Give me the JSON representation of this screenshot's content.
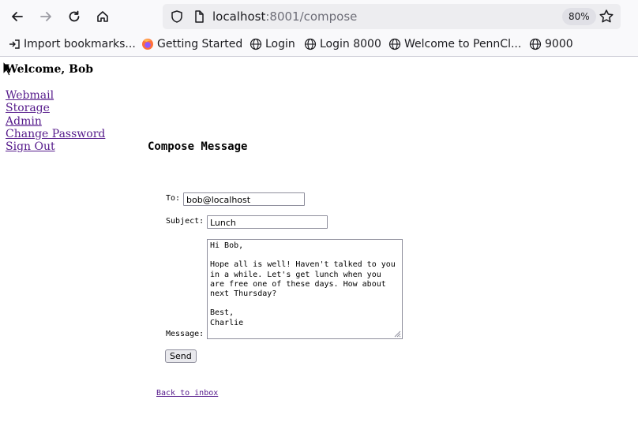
{
  "browser": {
    "url_host": "localhost",
    "url_rest": ":8001/compose",
    "zoom": "80%",
    "bookmarks": [
      {
        "label": "Import bookmarks...",
        "icon": "import-icon"
      },
      {
        "label": "Getting Started",
        "icon": "firefox-icon"
      },
      {
        "label": "Login",
        "icon": "globe-icon"
      },
      {
        "label": "Login 8000",
        "icon": "globe-icon"
      },
      {
        "label": "Welcome to PennCl...",
        "icon": "globe-icon"
      },
      {
        "label": "9000",
        "icon": "globe-icon"
      }
    ]
  },
  "page": {
    "welcome": "Welcome, Bob",
    "nav": [
      "Webmail",
      "Storage",
      "Admin",
      "Change Password",
      "Sign Out"
    ],
    "heading": "Compose Message",
    "form": {
      "to_label": "To:",
      "to_value": "bob@localhost",
      "subject_label": "Subject:",
      "subject_value": "Lunch",
      "message_label": "Message:",
      "message_value": "Hi Bob,\n\nHope all is well! Haven't talked to you in a while. Let's get lunch when you are free one of these days. How about next Thursday?\n\nBest,\nCharlie",
      "send_label": "Send"
    },
    "back_link": "Back to inbox"
  },
  "colors": {
    "link_visited": "#551a8b",
    "urlbar_bg": "#ededf0"
  }
}
